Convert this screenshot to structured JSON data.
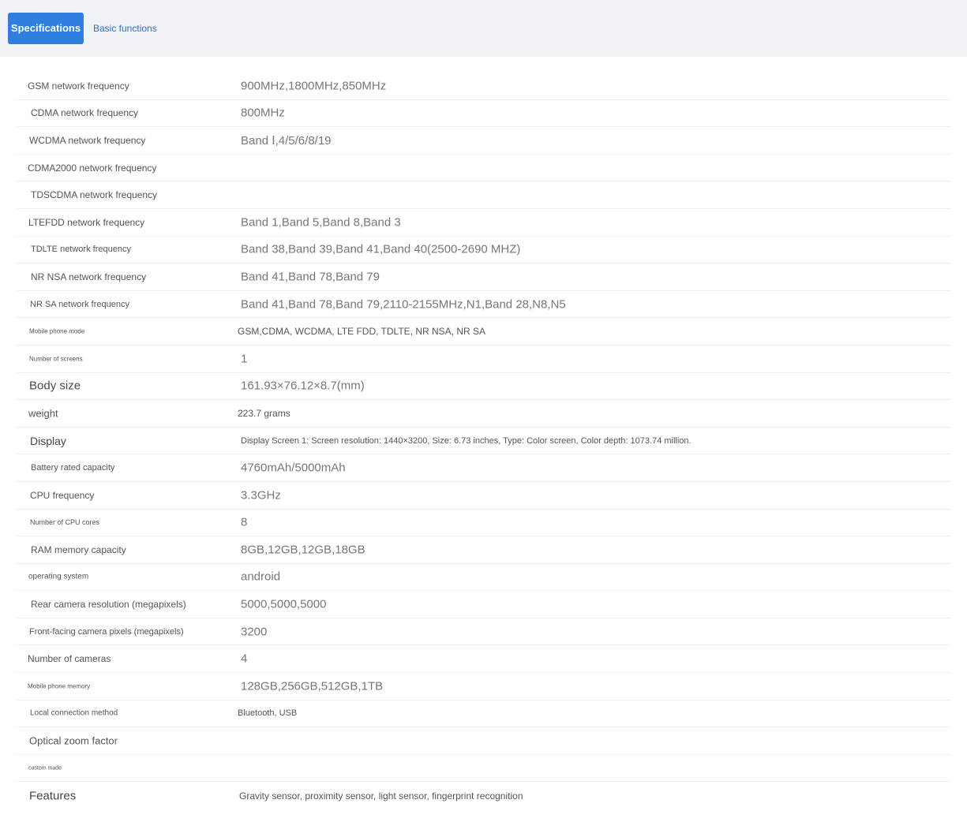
{
  "tabs": [
    {
      "label": "Specifications",
      "active": true
    },
    {
      "label": "Basic functions",
      "active": false
    }
  ],
  "specs": [
    {
      "label": "GSM network frequency",
      "value": "900MHz,1800MHz,850MHz"
    },
    {
      "label": "CDMA network frequency",
      "value": "800MHz"
    },
    {
      "label": "WCDMA network frequency",
      "value": "Band Ⅰ,4/5/6/8/19"
    },
    {
      "label": "CDMA2000 network frequency",
      "value": ""
    },
    {
      "label": "TDSCDMA network frequency",
      "value": ""
    },
    {
      "label": "LTEFDD network frequency",
      "value": "Band 1,Band 5,Band 8,Band 3"
    },
    {
      "label": "TDLTE network frequency",
      "value": "Band 38,Band 39,Band 41,Band 40(2500-2690 MHZ)"
    },
    {
      "label": "NR NSA network frequency",
      "value": "Band 41,Band 78,Band 79"
    },
    {
      "label": "NR SA network frequency",
      "value": "Band 41,Band 78,Band 79,2110-2155MHz,N1,Band 28,N8,N5"
    },
    {
      "label": "Mobile phone mode",
      "value": "GSM,CDMA, WCDMA, LTE FDD, TDLTE, NR NSA, NR SA"
    },
    {
      "label": "Number of screens",
      "value": "1"
    },
    {
      "label": "Body size",
      "value": "161.93×76.12×8.7(mm)"
    },
    {
      "label": "weight",
      "value": "223.7 grams"
    },
    {
      "label": "Display",
      "value": "Display Screen 1: Screen resolution: 1440×3200, Size: 6.73 inches, Type: Color screen, Color depth: 1073.74 million."
    },
    {
      "label": "Battery rated capacity",
      "value": "4760mAh/5000mAh"
    },
    {
      "label": "CPU frequency",
      "value": "3.3GHz"
    },
    {
      "label": "Number of CPU cores",
      "value": "8"
    },
    {
      "label": "RAM memory capacity",
      "value": "8GB,12GB,12GB,18GB"
    },
    {
      "label": "operating system",
      "value": "android"
    },
    {
      "label": "Rear camera resolution (megapixels)",
      "value": "5000,5000,5000"
    },
    {
      "label": "Front-facing camera pixels (megapixels)",
      "value": "3200"
    },
    {
      "label": "Number of cameras",
      "value": "4"
    },
    {
      "label": "Mobile phone memory",
      "value": "128GB,256GB,512GB,1TB"
    },
    {
      "label": "Local connection method",
      "value": "Bluetooth, USB"
    },
    {
      "label": "Optical zoom factor",
      "value": ""
    },
    {
      "label": "custom made",
      "value": ""
    },
    {
      "label": "Features",
      "value": "Gravity sensor, proximity sensor, light sensor, fingerprint recognition"
    }
  ]
}
